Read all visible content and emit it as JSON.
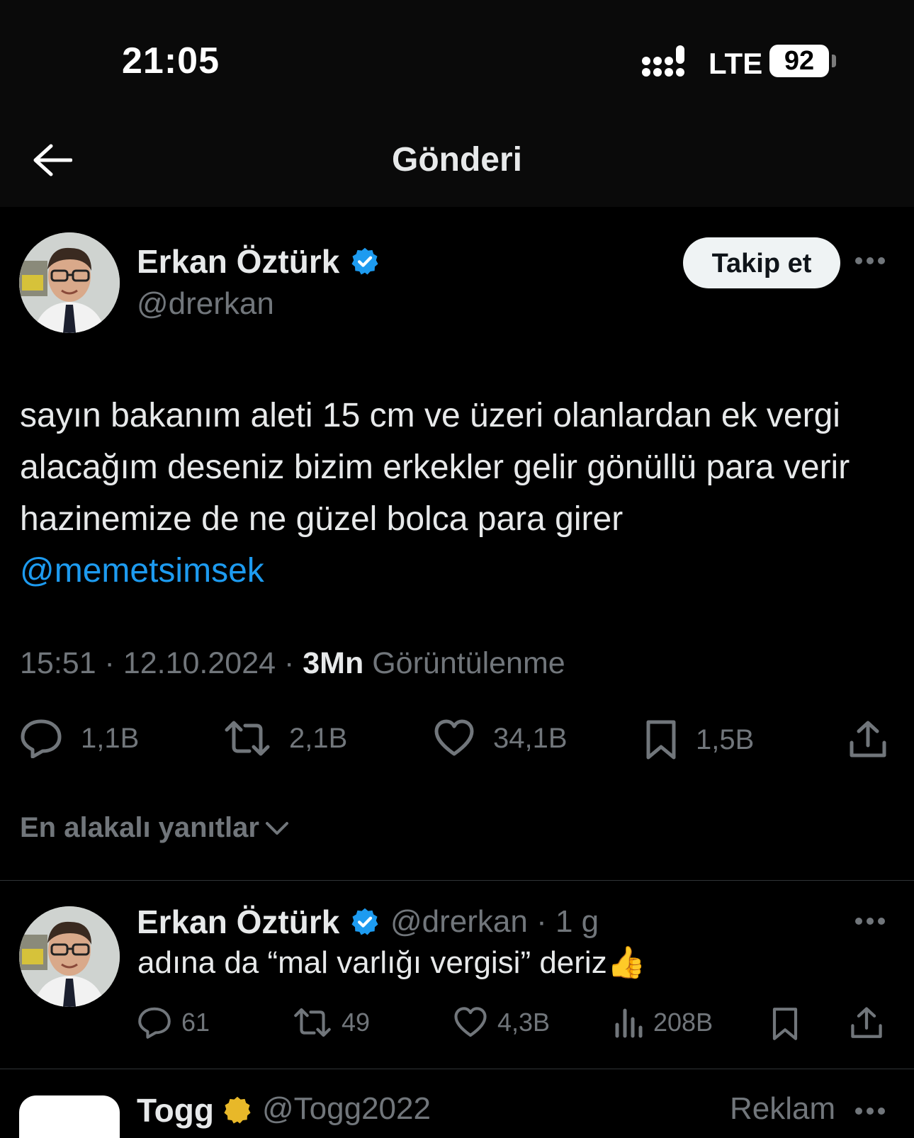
{
  "status_bar": {
    "time": "21:05",
    "network": "LTE",
    "battery": "92"
  },
  "header": {
    "title": "Gönderi"
  },
  "tweet": {
    "author_name": "Erkan Öztürk",
    "handle": "@drerkan",
    "follow_label": "Takip et",
    "text": "sayın bakanım aleti 15 cm ve üzeri olanlardan ek vergi alacağım deseniz bizim erkekler gelir gönüllü para verir hazinemize de ne güzel bolca para girer",
    "mention": "@memetsimsek",
    "time": "15:51",
    "date": "12.10.2024",
    "views_count": "3Mn",
    "views_label": "Görüntülenme",
    "replies": "1,1B",
    "retweets": "2,1B",
    "likes": "34,1B",
    "bookmarks": "1,5B"
  },
  "replies_sort": {
    "label": "En alakalı yanıtlar"
  },
  "reply": {
    "author_name": "Erkan Öztürk",
    "handle_time": "@drerkan · 1 g",
    "text": "adına da “mal varlığı vergisi” deriz",
    "emoji": "👍",
    "replies": "61",
    "retweets": "49",
    "likes": "4,3B",
    "views": "208B"
  },
  "ad": {
    "author_name": "Togg",
    "handle": "@Togg2022",
    "label": "Reklam"
  },
  "colors": {
    "background": "#000000",
    "accent": "#1d9bf0",
    "secondary_text": "#71767b",
    "divider": "#2f3336"
  },
  "icons": [
    "back-arrow-icon",
    "verified-badge-icon",
    "more-options-icon",
    "reply-icon",
    "retweet-icon",
    "like-icon",
    "bookmark-icon",
    "share-icon",
    "views-icon",
    "chevron-down-icon"
  ]
}
